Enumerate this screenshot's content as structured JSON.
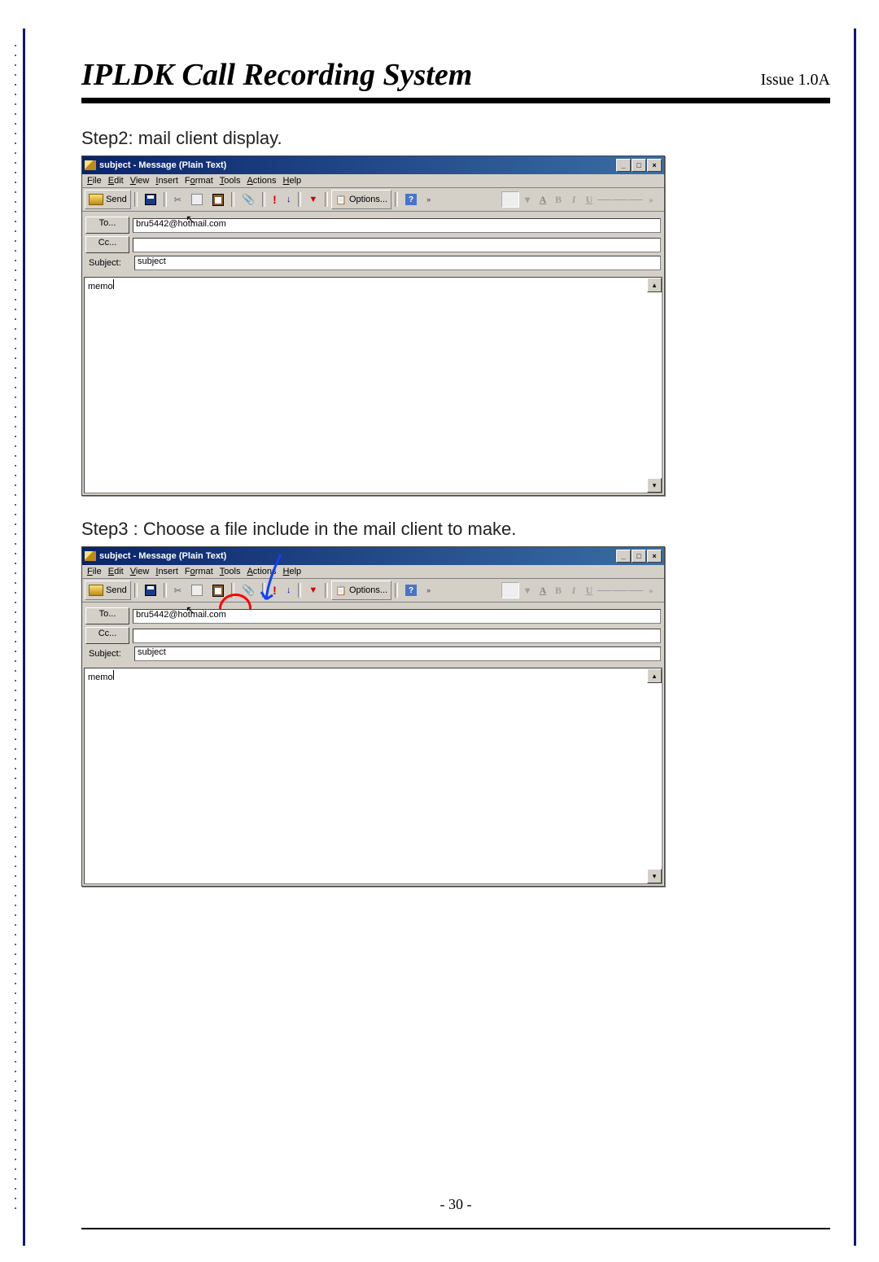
{
  "doc": {
    "title": "IPLDK Call Recording System",
    "issue": "Issue 1.0A",
    "page_number": "- 30 -"
  },
  "steps": {
    "step2_text": "Step2: mail client display.",
    "step3_text": "Step3 : Choose a file include in the mail client to make."
  },
  "mail_window_1": {
    "title": "subject - Message (Plain Text)",
    "menubar": [
      "File",
      "Edit",
      "View",
      "Insert",
      "Format",
      "Tools",
      "Actions",
      "Help"
    ],
    "toolbar": {
      "send_label": "Send",
      "options_label": "Options..."
    },
    "to_btn": "To...",
    "to_value": "bru5442@hotmail.com",
    "cc_btn": "Cc...",
    "cc_value": "",
    "subject_label": "Subject:",
    "subject_value": "subject",
    "body_value": "memo"
  },
  "mail_window_2": {
    "title": "subject - Message (Plain Text)",
    "menubar": [
      "File",
      "Edit",
      "View",
      "Insert",
      "Format",
      "Tools",
      "Actions",
      "Help"
    ],
    "toolbar": {
      "send_label": "Send",
      "options_label": "Options..."
    },
    "to_btn": "To...",
    "to_value": "bru5442@hotmail.com",
    "cc_btn": "Cc...",
    "cc_value": "",
    "subject_label": "Subject:",
    "subject_value": "subject",
    "body_value": "memo"
  },
  "format_buttons": {
    "bold": "B",
    "italic": "I",
    "underline": "U"
  }
}
